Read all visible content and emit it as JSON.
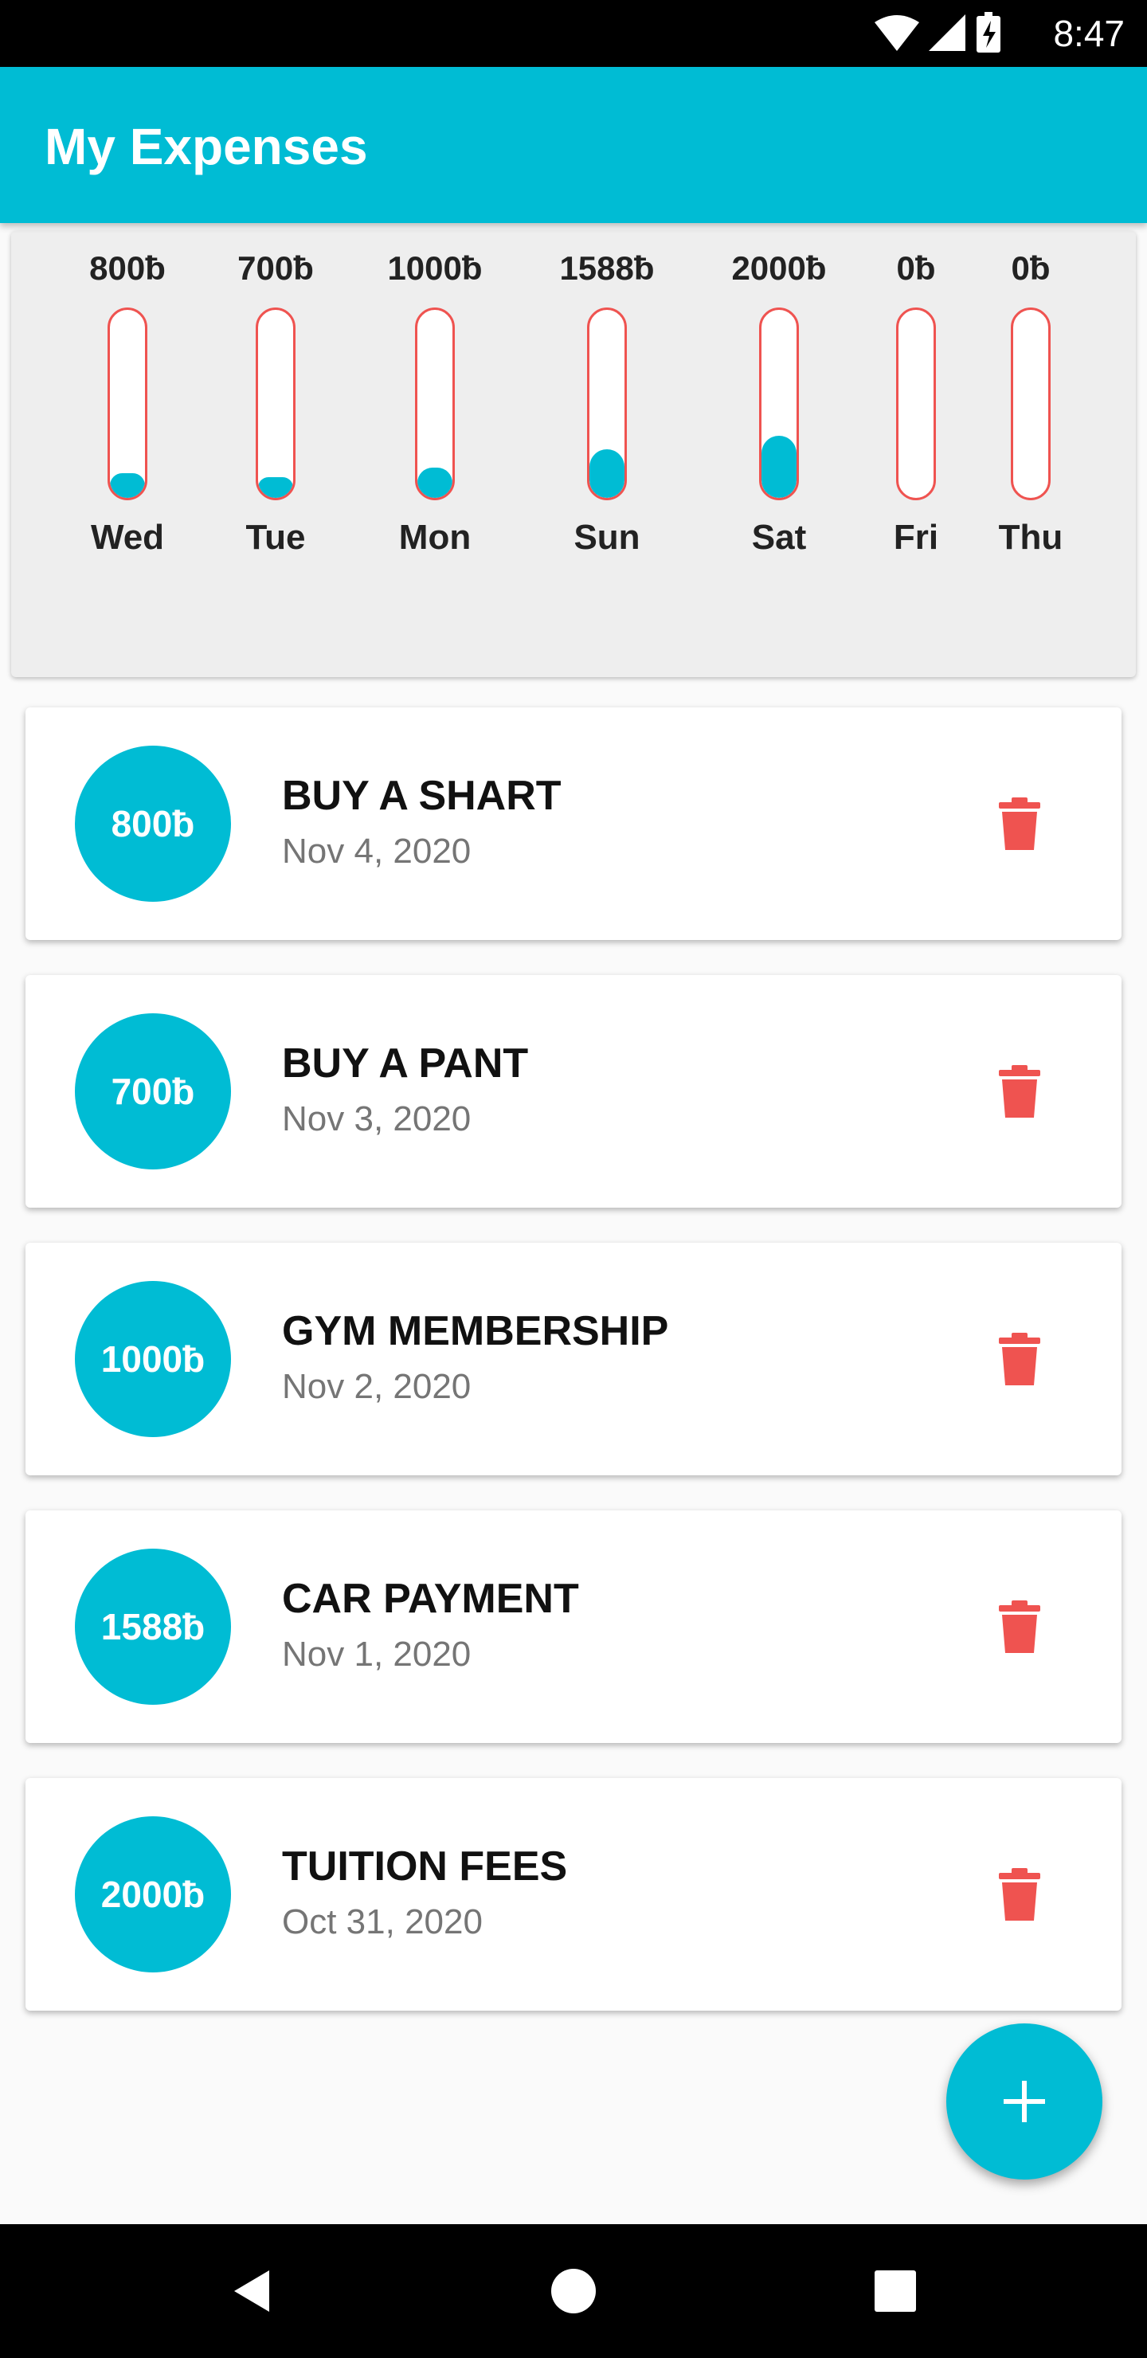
{
  "status_bar": {
    "time": "8:47"
  },
  "app_bar": {
    "title": "My Expenses"
  },
  "colors": {
    "accent": "#00bcd4",
    "danger": "#ef5350"
  },
  "chart_data": {
    "type": "bar",
    "categories": [
      "Wed",
      "Tue",
      "Mon",
      "Sun",
      "Sat",
      "Fri",
      "Thu"
    ],
    "amount_labels": [
      "800ƀ",
      "700ƀ",
      "1000ƀ",
      "1588ƀ",
      "2000ƀ",
      "0ƀ",
      "0ƀ"
    ],
    "values": [
      800,
      700,
      1000,
      1588,
      2000,
      0,
      0
    ],
    "fill_fraction": [
      0.13,
      0.11,
      0.16,
      0.26,
      0.33,
      0,
      0
    ]
  },
  "expenses": [
    {
      "amount": "800ƀ",
      "title": "BUY A SHART",
      "date": "Nov 4, 2020"
    },
    {
      "amount": "700ƀ",
      "title": "BUY A PANT",
      "date": "Nov 3, 2020"
    },
    {
      "amount": "1000ƀ",
      "title": "GYM MEMBERSHIP",
      "date": "Nov 2, 2020"
    },
    {
      "amount": "1588ƀ",
      "title": "CAR PAYMENT",
      "date": "Nov 1, 2020"
    },
    {
      "amount": "2000ƀ",
      "title": "TUITION FEES",
      "date": "Oct 31, 2020"
    }
  ],
  "icons": {
    "delete": "trash-icon",
    "fab": "add-icon",
    "nav": [
      "back-icon",
      "home-icon",
      "recents-icon"
    ],
    "status": [
      "wifi-icon",
      "signal-icon",
      "battery-charging-icon"
    ]
  }
}
